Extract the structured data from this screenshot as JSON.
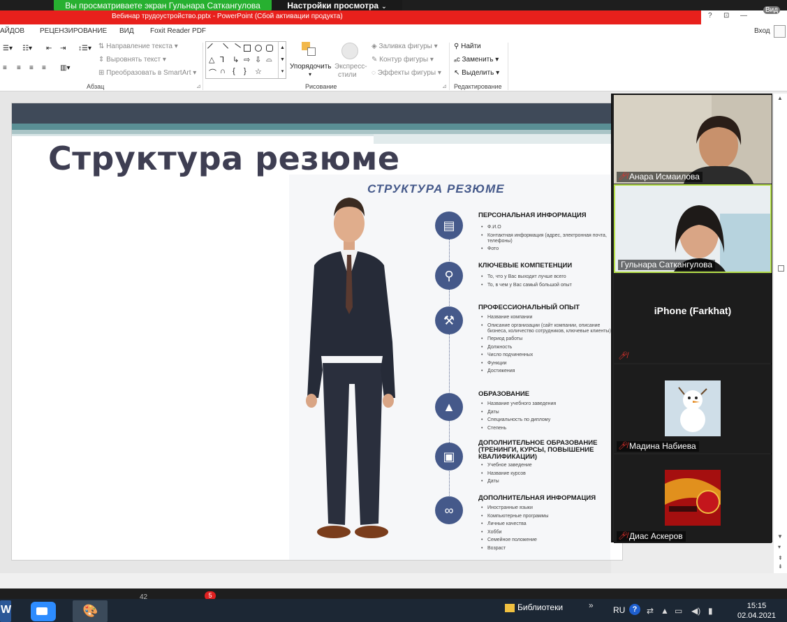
{
  "zoom": {
    "banner": "Вы просматриваете экран Гульнара Саткангулова",
    "view_settings": "Настройки просмотра",
    "vid_label": "Вид",
    "participants": [
      {
        "name": "Анара Исмаилова"
      },
      {
        "name": "Гульнара Саткангулова"
      },
      {
        "name": "",
        "device_label": "iPhone (Farkhat)"
      },
      {
        "name": "Мадина Набиева"
      },
      {
        "name": "Диас Аскеров"
      }
    ],
    "chat_badge": "5",
    "participant_count": "42"
  },
  "powerpoint": {
    "title": "Вебинар трудоустройство.pptx - PowerPoint (Сбой активации продукта)",
    "help": "?",
    "signin": "Вход",
    "tabs": [
      "АЙДОВ",
      "РЕЦЕНЗИРОВАНИЕ",
      "ВИД",
      "Foxit Reader PDF"
    ],
    "ribbon": {
      "paragraph": {
        "label": "Абзац",
        "text_direction": "Направление текста",
        "align_text": "Выровнять текст",
        "convert_smartart": "Преобразовать в SmartArt"
      },
      "drawing": {
        "label": "Рисование",
        "arrange": "Упорядочить",
        "express": "Экспресс-",
        "styles": "стили",
        "fill": "Заливка фигуры",
        "outline": "Контур фигуры",
        "effects": "Эффекты фигуры"
      },
      "editing": {
        "label": "Редактирование",
        "find": "Найти",
        "replace": "Заменить",
        "select": "Выделить"
      }
    }
  },
  "slide": {
    "title": "Структура резюме",
    "panel_heading": "СТРУКТУРА РЕЗЮМЕ",
    "sections": [
      {
        "title": "ПЕРСОНАЛЬНАЯ ИНФОРМАЦИЯ",
        "icon": "book-icon",
        "items": [
          "Ф.И.О",
          "Контактная информация (адрес, электронная почта, телефоны)",
          "Фото"
        ]
      },
      {
        "title": "КЛЮЧЕВЫЕ КОМПЕТЕНЦИИ",
        "icon": "key-icon",
        "items": [
          "То, что у Вас выходит лучше всего",
          "То, в чем у Вас самый большой опыт"
        ]
      },
      {
        "title": "ПРОФЕССИОНАЛЬНЫЙ ОПЫТ",
        "icon": "shovel-icon",
        "items": [
          "Название компании",
          "Описание организации (сайт компании, описание бизнеса, количество сотрудников, ключевые клиенты)",
          "Период работы",
          "Должность",
          "Число подчиненных",
          "Функции",
          "Достижения"
        ]
      },
      {
        "title": "ОБРАЗОВАНИЕ",
        "icon": "graduation-cap-icon",
        "items": [
          "Название учебного заведения",
          "Даты",
          "Специальность по диплому",
          "Степень"
        ]
      },
      {
        "title": "ДОПОЛНИТЕЛЬНОЕ ОБРАЗОВАНИЕ (ТРЕНИНГИ, КУРСЫ, ПОВЫШЕНИЕ КВАЛИФИКАЦИИ)",
        "icon": "briefcase-icon",
        "items": [
          "Учебное заведение",
          "Название курсов",
          "Даты"
        ]
      },
      {
        "title": "ДОПОЛНИТЕЛЬНАЯ ИНФОРМАЦИЯ",
        "icon": "paperclip-icon",
        "items": [
          "Иностранные языки",
          "Компьютерные программы",
          "Личные качества",
          "Хобби",
          "Семейное положение",
          "Возраст"
        ]
      }
    ]
  },
  "taskbar": {
    "libraries": "Библиотеки",
    "language": "RU",
    "time": "15:15",
    "date": "02.04.2021"
  },
  "colors": {
    "zoom_green": "#27b030",
    "ppt_red": "#e8201c",
    "slide_accent": "#45598a",
    "active_tile_border": "#b6e04a"
  }
}
